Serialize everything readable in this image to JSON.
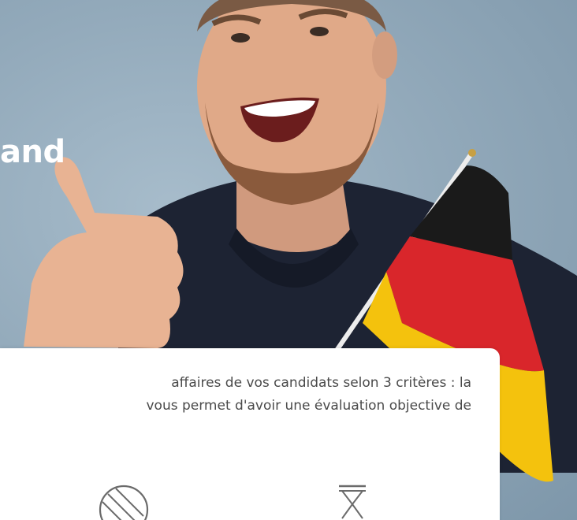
{
  "hero": {
    "title": "and"
  },
  "card": {
    "line1": "affaires de vos candidats selon 3 critères : la",
    "line2": "vous permet d'avoir une évaluation objective de"
  },
  "icons": [
    "ball-badge-icon",
    "hourglass-icon"
  ],
  "colors": {
    "card_background": "#ffffff",
    "text": "#4a4a4a",
    "icon_stroke": "#6b6b6b",
    "flag_black": "#1a1a1a",
    "flag_red": "#d9262b",
    "flag_gold": "#f4c20d"
  }
}
